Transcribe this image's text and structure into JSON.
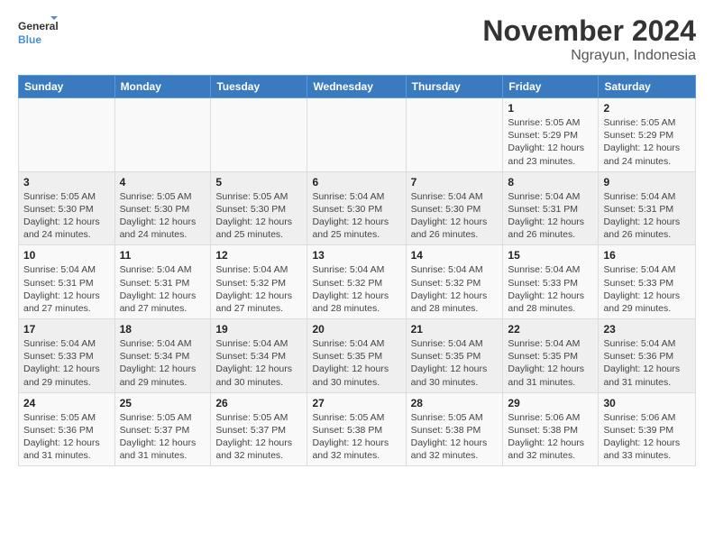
{
  "logo": {
    "line1": "General",
    "line2": "Blue"
  },
  "header": {
    "title": "November 2024",
    "subtitle": "Ngrayun, Indonesia"
  },
  "weekdays": [
    "Sunday",
    "Monday",
    "Tuesday",
    "Wednesday",
    "Thursday",
    "Friday",
    "Saturday"
  ],
  "weeks": [
    [
      {
        "day": "",
        "info": ""
      },
      {
        "day": "",
        "info": ""
      },
      {
        "day": "",
        "info": ""
      },
      {
        "day": "",
        "info": ""
      },
      {
        "day": "",
        "info": ""
      },
      {
        "day": "1",
        "info": "Sunrise: 5:05 AM\nSunset: 5:29 PM\nDaylight: 12 hours and 23 minutes."
      },
      {
        "day": "2",
        "info": "Sunrise: 5:05 AM\nSunset: 5:29 PM\nDaylight: 12 hours and 24 minutes."
      }
    ],
    [
      {
        "day": "3",
        "info": "Sunrise: 5:05 AM\nSunset: 5:30 PM\nDaylight: 12 hours and 24 minutes."
      },
      {
        "day": "4",
        "info": "Sunrise: 5:05 AM\nSunset: 5:30 PM\nDaylight: 12 hours and 24 minutes."
      },
      {
        "day": "5",
        "info": "Sunrise: 5:05 AM\nSunset: 5:30 PM\nDaylight: 12 hours and 25 minutes."
      },
      {
        "day": "6",
        "info": "Sunrise: 5:04 AM\nSunset: 5:30 PM\nDaylight: 12 hours and 25 minutes."
      },
      {
        "day": "7",
        "info": "Sunrise: 5:04 AM\nSunset: 5:30 PM\nDaylight: 12 hours and 26 minutes."
      },
      {
        "day": "8",
        "info": "Sunrise: 5:04 AM\nSunset: 5:31 PM\nDaylight: 12 hours and 26 minutes."
      },
      {
        "day": "9",
        "info": "Sunrise: 5:04 AM\nSunset: 5:31 PM\nDaylight: 12 hours and 26 minutes."
      }
    ],
    [
      {
        "day": "10",
        "info": "Sunrise: 5:04 AM\nSunset: 5:31 PM\nDaylight: 12 hours and 27 minutes."
      },
      {
        "day": "11",
        "info": "Sunrise: 5:04 AM\nSunset: 5:31 PM\nDaylight: 12 hours and 27 minutes."
      },
      {
        "day": "12",
        "info": "Sunrise: 5:04 AM\nSunset: 5:32 PM\nDaylight: 12 hours and 27 minutes."
      },
      {
        "day": "13",
        "info": "Sunrise: 5:04 AM\nSunset: 5:32 PM\nDaylight: 12 hours and 28 minutes."
      },
      {
        "day": "14",
        "info": "Sunrise: 5:04 AM\nSunset: 5:32 PM\nDaylight: 12 hours and 28 minutes."
      },
      {
        "day": "15",
        "info": "Sunrise: 5:04 AM\nSunset: 5:33 PM\nDaylight: 12 hours and 28 minutes."
      },
      {
        "day": "16",
        "info": "Sunrise: 5:04 AM\nSunset: 5:33 PM\nDaylight: 12 hours and 29 minutes."
      }
    ],
    [
      {
        "day": "17",
        "info": "Sunrise: 5:04 AM\nSunset: 5:33 PM\nDaylight: 12 hours and 29 minutes."
      },
      {
        "day": "18",
        "info": "Sunrise: 5:04 AM\nSunset: 5:34 PM\nDaylight: 12 hours and 29 minutes."
      },
      {
        "day": "19",
        "info": "Sunrise: 5:04 AM\nSunset: 5:34 PM\nDaylight: 12 hours and 30 minutes."
      },
      {
        "day": "20",
        "info": "Sunrise: 5:04 AM\nSunset: 5:35 PM\nDaylight: 12 hours and 30 minutes."
      },
      {
        "day": "21",
        "info": "Sunrise: 5:04 AM\nSunset: 5:35 PM\nDaylight: 12 hours and 30 minutes."
      },
      {
        "day": "22",
        "info": "Sunrise: 5:04 AM\nSunset: 5:35 PM\nDaylight: 12 hours and 31 minutes."
      },
      {
        "day": "23",
        "info": "Sunrise: 5:04 AM\nSunset: 5:36 PM\nDaylight: 12 hours and 31 minutes."
      }
    ],
    [
      {
        "day": "24",
        "info": "Sunrise: 5:05 AM\nSunset: 5:36 PM\nDaylight: 12 hours and 31 minutes."
      },
      {
        "day": "25",
        "info": "Sunrise: 5:05 AM\nSunset: 5:37 PM\nDaylight: 12 hours and 31 minutes."
      },
      {
        "day": "26",
        "info": "Sunrise: 5:05 AM\nSunset: 5:37 PM\nDaylight: 12 hours and 32 minutes."
      },
      {
        "day": "27",
        "info": "Sunrise: 5:05 AM\nSunset: 5:38 PM\nDaylight: 12 hours and 32 minutes."
      },
      {
        "day": "28",
        "info": "Sunrise: 5:05 AM\nSunset: 5:38 PM\nDaylight: 12 hours and 32 minutes."
      },
      {
        "day": "29",
        "info": "Sunrise: 5:06 AM\nSunset: 5:38 PM\nDaylight: 12 hours and 32 minutes."
      },
      {
        "day": "30",
        "info": "Sunrise: 5:06 AM\nSunset: 5:39 PM\nDaylight: 12 hours and 33 minutes."
      }
    ]
  ]
}
